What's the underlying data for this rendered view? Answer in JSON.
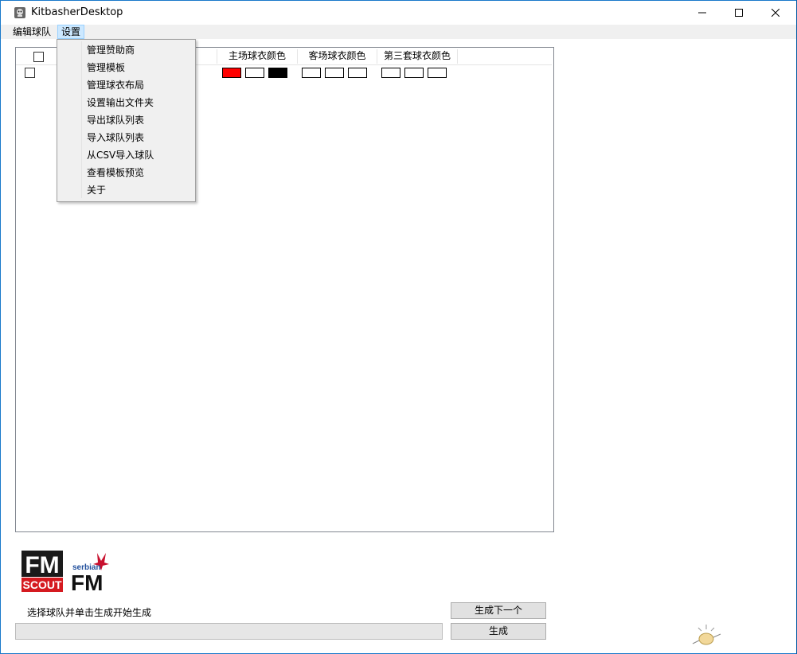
{
  "window": {
    "title": "KitbasherDesktop",
    "icon": "app-icon"
  },
  "menubar": {
    "edit_teams": "编辑球队",
    "settings": "设置"
  },
  "settings_menu": {
    "items": [
      "管理赞助商",
      "管理模板",
      "管理球衣布局",
      "设置输出文件夹",
      "导出球队列表",
      "导入球队列表",
      "从CSV导入球队",
      "查看模板预览",
      "关于"
    ]
  },
  "table": {
    "headers": {
      "home": "主场球衣颜色",
      "away": "客场球衣颜色",
      "third": "第三套球衣颜色"
    },
    "rows": [
      {
        "checked": false,
        "home_colors": [
          "#ff0000",
          "#ffffff",
          "#000000"
        ],
        "away_colors": [
          "#ffffff",
          "#ffffff",
          "#ffffff"
        ],
        "third_colors": [
          "#ffffff",
          "#ffffff",
          "#ffffff"
        ]
      }
    ]
  },
  "logos": {
    "fm_scout_top": "FM",
    "fm_scout_bottom": "SCOUT",
    "serbian_top": "serbian",
    "serbian_bottom": "FM"
  },
  "status": {
    "message": "选择球队并单击生成开始生成",
    "progress": 0
  },
  "buttons": {
    "generate_next": "生成下一个",
    "generate": "生成"
  },
  "colors": {
    "accent": "#1979ca",
    "menu_highlight": "#cce8ff"
  }
}
